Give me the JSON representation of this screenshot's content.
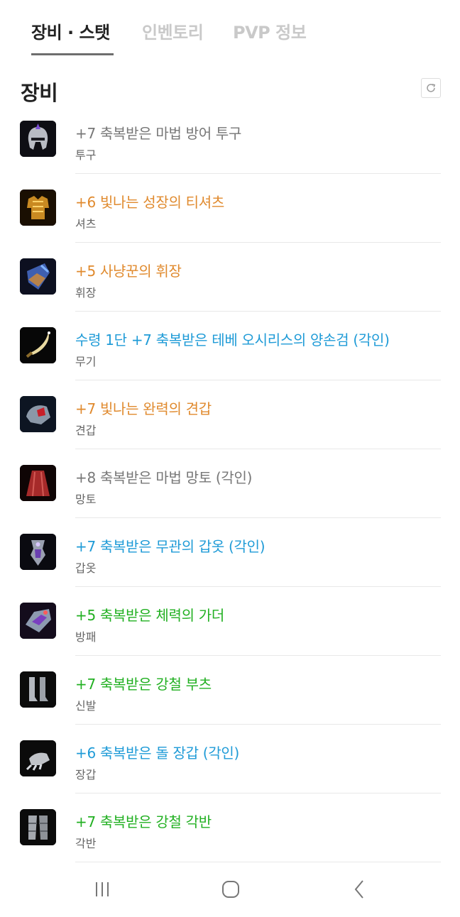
{
  "tabs": [
    {
      "label": "장비 · 스탯",
      "active": true
    },
    {
      "label": "인벤토리",
      "active": false
    },
    {
      "label": "PVP 정보",
      "active": false
    }
  ],
  "section": {
    "title": "장비",
    "refresh_icon": "refresh-icon"
  },
  "equipment": [
    {
      "name": "+7  축복받은 마법 방어 투구",
      "slot": "투구",
      "color": "#777777",
      "icon": "helmet-icon"
    },
    {
      "name": "+6  빛나는 성장의 티셔츠",
      "slot": "셔츠",
      "color": "#e08a2e",
      "icon": "shirt-icon"
    },
    {
      "name": "+5  사냥꾼의 휘장",
      "slot": "휘장",
      "color": "#e08a2e",
      "icon": "emblem-icon"
    },
    {
      "name": "수령 1단 +7  축복받은 테베 오시리스의 양손검 (각인)",
      "slot": "무기",
      "color": "#1f9bd7",
      "icon": "sword-icon"
    },
    {
      "name": "+7  빛나는 완력의 견갑",
      "slot": "견갑",
      "color": "#e08a2e",
      "icon": "pauldron-icon"
    },
    {
      "name": "+8  축복받은 마법 망토 (각인)",
      "slot": "망토",
      "color": "#777777",
      "icon": "cloak-icon"
    },
    {
      "name": "+7  축복받은 무관의 갑옷 (각인)",
      "slot": "갑옷",
      "color": "#1f9bd7",
      "icon": "armor-icon"
    },
    {
      "name": "+5  축복받은 체력의 가더",
      "slot": "방패",
      "color": "#22b022",
      "icon": "guarder-icon"
    },
    {
      "name": "+7  축복받은 강철 부츠",
      "slot": "신발",
      "color": "#22b022",
      "icon": "boots-icon"
    },
    {
      "name": "+6  축복받은 돌 장갑 (각인)",
      "slot": "장갑",
      "color": "#1f9bd7",
      "icon": "gloves-icon"
    },
    {
      "name": "+7  축복받은 강철 각반",
      "slot": "각반",
      "color": "#22b022",
      "icon": "greaves-icon"
    }
  ],
  "navbar": {
    "recent_icon": "recent-apps-icon",
    "home_icon": "home-icon",
    "back_icon": "back-icon"
  }
}
